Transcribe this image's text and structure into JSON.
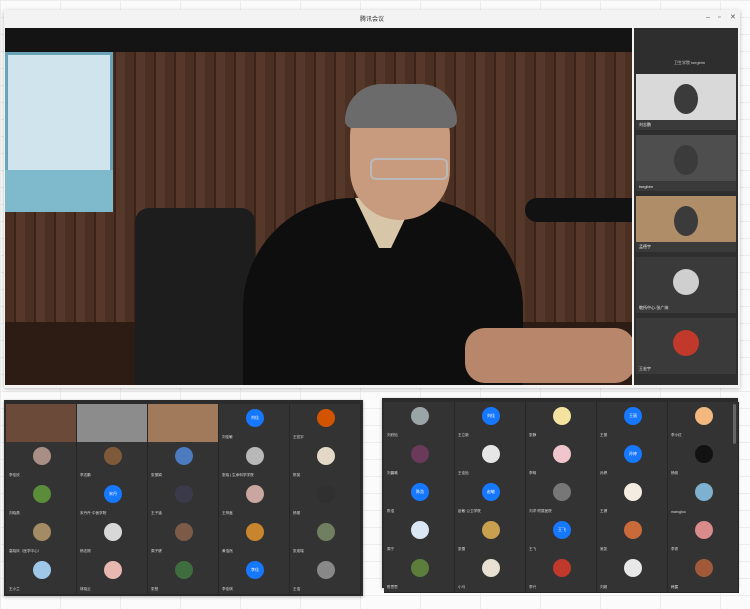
{
  "window": {
    "title": "腾讯会议",
    "controls": [
      "–",
      "▫",
      "✕"
    ]
  },
  "sidebar": {
    "header_label": "卫生学院 tsegbim",
    "tiles": [
      {
        "name": "刘志鹏",
        "kind": "video"
      },
      {
        "name": "tsegbim",
        "kind": "video"
      },
      {
        "name": "孟德宇",
        "kind": "video"
      },
      {
        "name": "敬所中心-张广纳",
        "kind": "avatar",
        "color": "#cfcfcf"
      },
      {
        "name": "王宏宇",
        "kind": "avatar",
        "color": "#c0392b"
      }
    ]
  },
  "grid_left": {
    "cells": [
      {
        "name": "",
        "kind": "video",
        "color": "#6b4a3a"
      },
      {
        "name": "",
        "kind": "video",
        "color": "#8c8c8c"
      },
      {
        "name": "",
        "kind": "video",
        "color": "#a07a5a"
      },
      {
        "name": "刘佳敏",
        "kind": "avatar",
        "initials": "刘佳",
        "color": "#1677ff"
      },
      {
        "name": "王宏宇",
        "kind": "avatar",
        "color": "#d35400"
      },
      {
        "name": "李佳欣",
        "kind": "avatar",
        "color": "#a88f86"
      },
      {
        "name": "李志鹏",
        "kind": "avatar",
        "color": "#7f5a3a"
      },
      {
        "name": "张丽娟",
        "kind": "avatar",
        "color": "#4d7bbf"
      },
      {
        "name": "张晓 | 生命科学学院",
        "kind": "avatar",
        "color": "#b8b8b8"
      },
      {
        "name": "陈英",
        "kind": "avatar",
        "color": "#e4d9c6"
      },
      {
        "name": "刘晓燕",
        "kind": "avatar",
        "color": "#5b8c3a"
      },
      {
        "name": "宋丹丹·中医学院",
        "kind": "avatar",
        "initials": "宋丹",
        "color": "#1677ff"
      },
      {
        "name": "王子涵",
        "kind": "avatar",
        "color": "#3a3a4a"
      },
      {
        "name": "王梓鑫",
        "kind": "avatar",
        "color": "#c9a6a0"
      },
      {
        "name": "杨丽",
        "kind": "avatar",
        "color": "#303030"
      },
      {
        "name": "高晓凤（医学中心）",
        "kind": "avatar",
        "color": "#a38b63"
      },
      {
        "name": "杨志刚",
        "kind": "avatar",
        "color": "#d8d8d8"
      },
      {
        "name": "周子健",
        "kind": "avatar",
        "color": "#7d5a48"
      },
      {
        "name": "黄浩然",
        "kind": "avatar",
        "color": "#c9852e"
      },
      {
        "name": "张成瑞",
        "kind": "avatar",
        "color": "#6f7f5f"
      },
      {
        "name": "王小兰",
        "kind": "avatar",
        "color": "#9fc8e8"
      },
      {
        "name": "林晓云",
        "kind": "avatar",
        "color": "#e7b7b0"
      },
      {
        "name": "张慧",
        "kind": "avatar",
        "color": "#3f6d3f"
      },
      {
        "name": "李佳琪",
        "kind": "avatar",
        "initials": "李佳",
        "color": "#1677ff"
      },
      {
        "name": "王浩",
        "kind": "avatar",
        "color": "#888"
      }
    ]
  },
  "grid_right": {
    "cells": [
      {
        "name": "刘欣怡",
        "kind": "avatar",
        "color": "#9aa5a8"
      },
      {
        "name": "王立新",
        "kind": "avatar",
        "initials": "刘佳",
        "color": "#1677ff"
      },
      {
        "name": "张静",
        "kind": "avatar",
        "color": "#f3e2a0"
      },
      {
        "name": "王丽",
        "kind": "avatar",
        "initials": "王丽",
        "color": "#1677ff"
      },
      {
        "name": "李小红",
        "kind": "avatar",
        "color": "#f2b880"
      },
      {
        "name": "刘晨曦",
        "kind": "avatar",
        "color": "#6a3a5a"
      },
      {
        "name": "王佳怡",
        "kind": "avatar",
        "color": "#e6e6e6"
      },
      {
        "name": "李明",
        "kind": "avatar",
        "color": "#f0c6cc"
      },
      {
        "name": "孙婷",
        "kind": "avatar",
        "initials": "孙婷",
        "color": "#1677ff"
      },
      {
        "name": "杨帆",
        "kind": "avatar",
        "color": "#121212"
      },
      {
        "name": "陈浩",
        "kind": "avatar",
        "initials": "陈浩",
        "color": "#1677ff"
      },
      {
        "name": "赵敏·公卫学院",
        "kind": "avatar",
        "initials": "赵敏",
        "color": "#1677ff"
      },
      {
        "name": "刘洋·附属医院",
        "kind": "avatar",
        "color": "#777"
      },
      {
        "name": "王健",
        "kind": "avatar",
        "color": "#f4ece0"
      },
      {
        "name": "marsgloo",
        "kind": "avatar",
        "color": "#7fb0cf"
      },
      {
        "name": "周宁",
        "kind": "avatar",
        "color": "#d9e8f4"
      },
      {
        "name": "张雪",
        "kind": "avatar",
        "color": "#c8a050"
      },
      {
        "name": "王飞",
        "kind": "avatar",
        "initials": "王飞",
        "color": "#1677ff"
      },
      {
        "name": "吴凯",
        "kind": "avatar",
        "color": "#c96a3a"
      },
      {
        "name": "李秀",
        "kind": "avatar",
        "color": "#d98a8a"
      },
      {
        "name": "陈思思",
        "kind": "avatar",
        "color": "#5d7d3d"
      },
      {
        "name": "小马",
        "kind": "avatar",
        "color": "#e8e0d0"
      },
      {
        "name": "李兴",
        "kind": "avatar",
        "color": "#c0392b"
      },
      {
        "name": "刘超",
        "kind": "avatar",
        "color": "#e8e8e8"
      },
      {
        "name": "韩露",
        "kind": "avatar",
        "color": "#a05a3a"
      }
    ]
  }
}
